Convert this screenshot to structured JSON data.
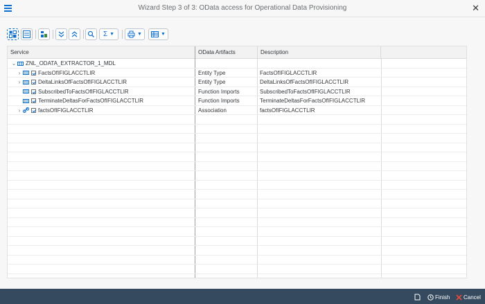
{
  "window": {
    "title": "Wizard Step 3 of 3: OData access for Operational Data Provisioning"
  },
  "icons": {
    "menu": "hamburger-menu-icon",
    "close": "close-icon"
  },
  "grid": {
    "columns": [
      "Service",
      "OData Artifacts",
      "Description"
    ],
    "root": {
      "label": "ZNL_ODATA_EXTRACTOR_1_MDL"
    },
    "rows": [
      {
        "service": "FactsOfIFIGLACCTLIR",
        "artifact": "Entity Type",
        "description": "FactsOfIFIGLACCTLIR"
      },
      {
        "service": "DeltaLinksOfFactsOfIFIGLACCTLIR",
        "artifact": "Entity Type",
        "description": "DeltaLinksOfFactsOfIFIGLACCTLIR"
      },
      {
        "service": "SubscribedToFactsOfIFIGLACCTLIR",
        "artifact": "Function Imports",
        "description": "SubscribedToFactsOfIFIGLACCTLIR"
      },
      {
        "service": "TerminateDeltasForFactsOfIFIGLACCTLIR",
        "artifact": "Function Imports",
        "description": "TerminateDeltasForFactsOfIFIGLACCTLIR"
      },
      {
        "service": "factsOfIFIGLACCTLIR",
        "artifact": "Association",
        "description": "factsOfIFIGLACCTLIR"
      }
    ]
  },
  "footer": {
    "finish": "Finish",
    "cancel": "Cancel"
  }
}
